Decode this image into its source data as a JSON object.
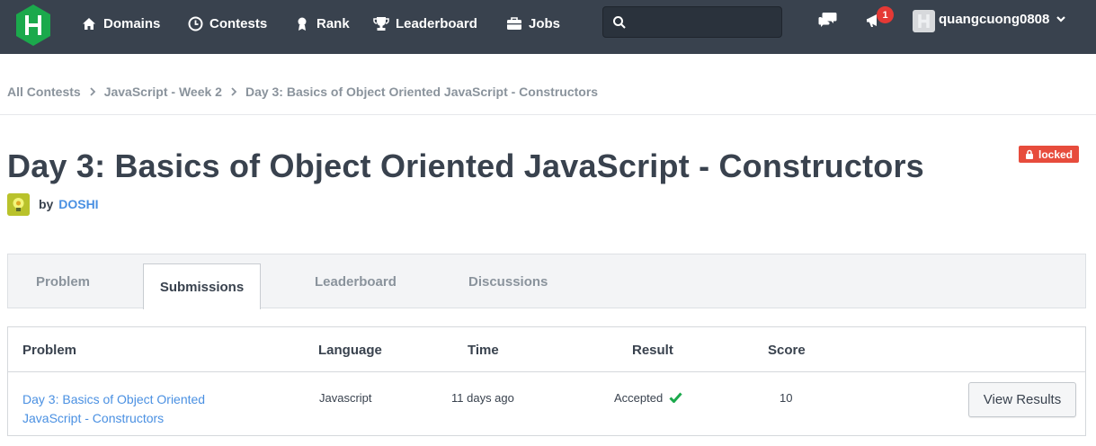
{
  "nav": {
    "items": [
      {
        "label": "Domains",
        "icon": "home-icon"
      },
      {
        "label": "Contests",
        "icon": "clock-icon"
      },
      {
        "label": "Rank",
        "icon": "medal-icon"
      },
      {
        "label": "Leaderboard",
        "icon": "trophy-icon"
      },
      {
        "label": "Jobs",
        "icon": "briefcase-icon"
      }
    ],
    "search_placeholder": "",
    "notification_count": "1",
    "username": "quangcuong0808"
  },
  "breadcrumb": [
    "All Contests",
    "JavaScript - Week 2",
    "Day 3: Basics of Object Oriented JavaScript - Constructors"
  ],
  "challenge": {
    "title": "Day 3: Basics of Object Oriented JavaScript - Constructors",
    "locked_label": "locked",
    "by_label": "by",
    "author": "DOSHI"
  },
  "tabs": [
    {
      "label": "Problem",
      "active": false
    },
    {
      "label": "Submissions",
      "active": true
    },
    {
      "label": "Leaderboard",
      "active": false
    },
    {
      "label": "Discussions",
      "active": false
    }
  ],
  "table": {
    "headers": [
      "Problem",
      "Language",
      "Time",
      "Result",
      "Score"
    ],
    "rows": [
      {
        "problem": "Day 3: Basics of Object Oriented JavaScript - Constructors",
        "language": "Javascript",
        "time": "11 days ago",
        "result": "Accepted",
        "score": "10",
        "action": "View Results"
      }
    ]
  },
  "colors": {
    "navbar": "#39424e",
    "brand_green": "#1ba94c",
    "link_blue": "#4a90e2",
    "locked_red": "#e74c3c",
    "accepted_green": "#1ba94c"
  }
}
